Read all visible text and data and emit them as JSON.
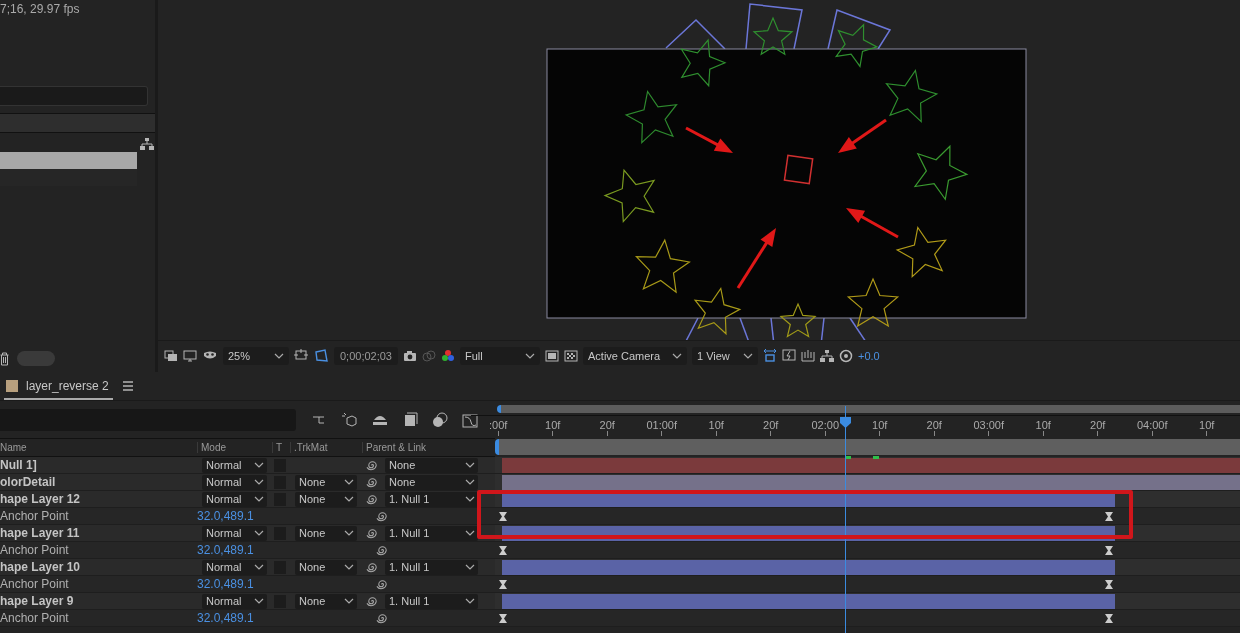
{
  "project_panel": {
    "info": "7;16, 29.97 fps",
    "items": [
      {
        "selected": true
      },
      {
        "selected": false
      }
    ]
  },
  "viewer_toolbar": {
    "zoom": "25%",
    "timecode": "0;00;02;03",
    "resolution": "Full",
    "view": "Active Camera",
    "layout": "1 View",
    "exposure": "+0.0"
  },
  "timeline": {
    "tab": {
      "label": "layer_reverse 2",
      "selected": true
    },
    "columns": [
      "Name",
      "Mode",
      "T",
      ".TrkMat",
      "Parent & Link"
    ],
    "ruler": [
      ":00f",
      "10f",
      "20f",
      "01:00f",
      "10f",
      "20f",
      "02:00",
      "10f",
      "20f",
      "03:00f",
      "10f",
      "20f",
      "04:00f",
      "10f"
    ],
    "layers": [
      {
        "kind": "layer",
        "name": "Null 1]",
        "mode": "Normal",
        "preserve_transparency": false,
        "parent": "None",
        "color": "#7b3a3c",
        "bar_extends": true
      },
      {
        "kind": "layer",
        "name": "olorDetail",
        "mode": "Normal",
        "preserve_transparency": false,
        "trkmat": "None",
        "parent": "None",
        "color": "#75718a",
        "bar_extends": true
      },
      {
        "kind": "layer",
        "name": "hape Layer 12",
        "mode": "Normal",
        "preserve_transparency": false,
        "trkmat": "None",
        "parent": "1. Null 1",
        "color": "#5a63a6",
        "bar_extends": false
      },
      {
        "kind": "property",
        "name": "Anchor Point",
        "value": "32.0,489.1"
      },
      {
        "kind": "layer",
        "name": "hape Layer 11",
        "mode": "Normal",
        "preserve_transparency": false,
        "trkmat": "None",
        "parent": "1. Null 1",
        "color": "#5a63a6",
        "bar_extends": false
      },
      {
        "kind": "property",
        "name": "Anchor Point",
        "value": "32.0,489.1"
      },
      {
        "kind": "layer",
        "name": "hape Layer 10",
        "mode": "Normal",
        "preserve_transparency": false,
        "trkmat": "None",
        "parent": "1. Null 1",
        "color": "#5a63a6",
        "bar_extends": false
      },
      {
        "kind": "property",
        "name": "Anchor Point",
        "value": "32.0,489.1"
      },
      {
        "kind": "layer",
        "name": "hape Layer 9",
        "mode": "Normal",
        "preserve_transparency": false,
        "trkmat": "None",
        "parent": "1. Null 1",
        "color": "#5a63a6",
        "bar_extends": false
      },
      {
        "kind": "property",
        "name": "Anchor Point",
        "value": "32.0,489.1"
      }
    ]
  }
}
